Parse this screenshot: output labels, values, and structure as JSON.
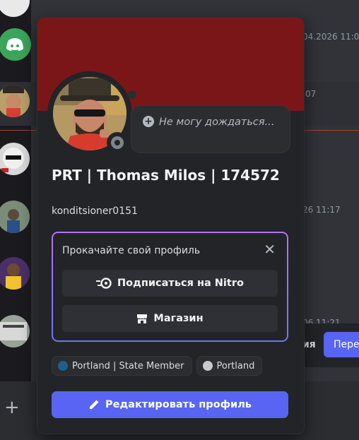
{
  "background": {
    "timestamps": [
      "04.2026 11:0",
      ":07",
      "26 11:17",
      "06 11:21"
    ],
    "toast": {
      "text": "ия",
      "button_label": "Пере"
    },
    "plus_label": "+"
  },
  "profile": {
    "banner_color": "#7a1617",
    "status": "offline",
    "custom_status": "Не могу дождаться...",
    "display_name": "PRT | Thomas Milos | 174572",
    "username": "konditsioner0151"
  },
  "upsell": {
    "title": "Прокачайте свой профиль",
    "close_label": "✕",
    "nitro_button": "Подписаться на Nitro",
    "shop_button": "Магазин"
  },
  "roles": [
    {
      "name": "Portland | State Member",
      "color": "#1f5f8b"
    },
    {
      "name": "Portland",
      "color": "#c7c9cc"
    }
  ],
  "edit_button": "Редактировать профиль",
  "colors": {
    "accent": "#5865f2",
    "nitro_gradient": [
      "#b473f5",
      "#6c78ee"
    ]
  }
}
